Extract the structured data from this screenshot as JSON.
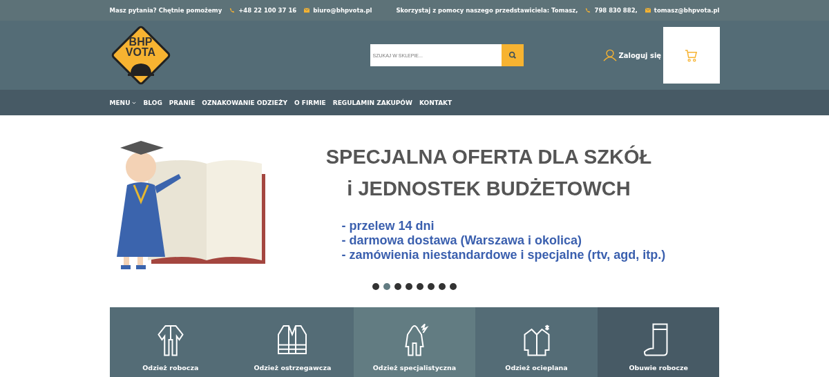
{
  "top_bar": {
    "question": "Masz pytania? Chętnie pomożemy",
    "phone": "+48 22 100 37 16",
    "email": "biuro@bhpvota.pl",
    "rep_text": "Skorzystaj z pomocy naszego przedstawiciela: Tomasz,",
    "rep_phone": "798 830 882,",
    "rep_email": "tomasz@bhpvota.pl"
  },
  "logo": {
    "line_1": "BHP",
    "line_2": "VOTA"
  },
  "search": {
    "placeholder": "SZUKAJ W SKLEPIE..."
  },
  "login": "Zaloguj się",
  "nav": [
    {
      "label": "MENU",
      "dropdown": true
    },
    {
      "label": "BLOG",
      "dropdown": false
    },
    {
      "label": "PRANIE",
      "dropdown": false
    },
    {
      "label": "OZNAKOWANIE ODZIEŻY",
      "dropdown": false
    },
    {
      "label": "O FIRMIE",
      "dropdown": false
    },
    {
      "label": "REGULAMIN ZAKUPÓW",
      "dropdown": false
    },
    {
      "label": "KONTAKT",
      "dropdown": false
    }
  ],
  "banner": {
    "headline_1": "SPECJALNA OFERTA DLA SZKÓŁ",
    "headline_2": "i JEDNOSTEK BUDŻETOWCH",
    "bullets": [
      "- przelew 14 dni",
      "- darmowa dostawa (Warszawa i okolica)",
      "- zamówienia niestandardowe i specjalne (rtv, agd, itp.)"
    ]
  },
  "carousel_dots": [
    {
      "selected": false
    },
    {
      "selected": true
    },
    {
      "selected": false
    },
    {
      "selected": false
    },
    {
      "selected": false
    },
    {
      "selected": false
    },
    {
      "selected": false
    },
    {
      "selected": false
    }
  ],
  "categories": [
    {
      "label": "Odzież robocza",
      "kind": "overall",
      "color": "#546c76"
    },
    {
      "label": "Odzież ostrzegawcza",
      "kind": "vest",
      "color": "#546c76"
    },
    {
      "label": "Odzież specjalistyczna",
      "kind": "suit",
      "color": "#627c82"
    },
    {
      "label": "Odzież ocieplana",
      "kind": "coat",
      "color": "#546c76"
    },
    {
      "label": "Obuwie robocze",
      "kind": "boot",
      "color": "#475a65"
    }
  ]
}
